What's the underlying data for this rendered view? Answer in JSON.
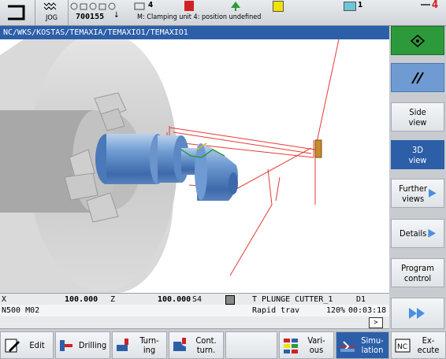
{
  "status": {
    "mode": "JOG",
    "program_no": "700155",
    "tool_count": "4",
    "channel_no": "1",
    "message": "M: Clamping unit 4: position undefined",
    "right_number": "4"
  },
  "path": "NC/WKS/KOSTAS/TEMAXIA/TEMAXIO1/TEMAXIO1",
  "info": {
    "x_label": "X",
    "x_value": "100.000",
    "z_label": "Z",
    "z_value": "100.000",
    "s_label": "S4",
    "tool_name": "T PLUNGE CUTTER_1",
    "d_label": "D1",
    "block": "N500 M02",
    "feed_mode": "Rapid trav",
    "override": "120%",
    "time": "00:03:18",
    "more": ">"
  },
  "right_softkeys": [
    {
      "label": "",
      "icon": "diamond-icon"
    },
    {
      "label": "",
      "icon": "double-slash-icon"
    },
    {
      "label": "Side\nview"
    },
    {
      "label": "3D\nview",
      "active": true
    },
    {
      "label": "Further\nviews"
    },
    {
      "label": "Details"
    },
    {
      "label": "Program\ncontrol"
    },
    {
      "label": "",
      "icon": "fast-forward-icon"
    }
  ],
  "bottom_softkeys": [
    {
      "label": "Edit"
    },
    {
      "label": "Drilling"
    },
    {
      "label": "Turn-\ning"
    },
    {
      "label": "Cont.\nturn."
    },
    {
      "label": ""
    },
    {
      "label": "Vari-\nous"
    },
    {
      "label": "Simu-\nlation",
      "active": true
    },
    {
      "label": "Ex-\necute"
    }
  ],
  "colors": {
    "accent_blue": "#2c5fa8",
    "active_softkey": "#2c5fa8",
    "red_alarm": "#d21f26",
    "yellow": "#f2e200",
    "green": "#2c9a3a"
  }
}
